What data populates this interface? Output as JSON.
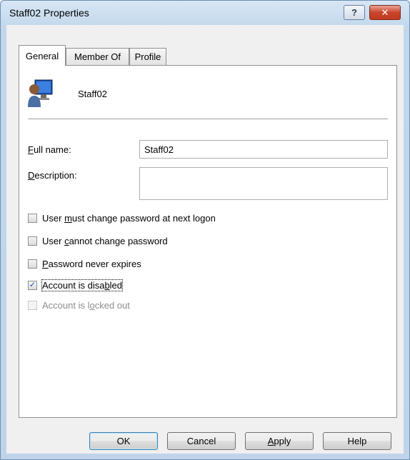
{
  "window": {
    "title": "Staff02 Properties",
    "help_label": "?",
    "close_label": "✕"
  },
  "tabs": [
    {
      "label": "General",
      "active": true
    },
    {
      "label": "Member Of",
      "active": false
    },
    {
      "label": "Profile",
      "active": false
    }
  ],
  "general": {
    "user_display_name": "Staff02",
    "user_icon": "user-computer-icon",
    "full_name": {
      "label_prefix": "",
      "label_accel": "F",
      "label_rest": "ull name:",
      "value": "Staff02"
    },
    "description": {
      "label_prefix": "",
      "label_accel": "D",
      "label_rest": "escription:",
      "value": ""
    },
    "checkboxes": [
      {
        "prefix": "User ",
        "accel": "m",
        "rest": "ust change password at next logon",
        "checked": false,
        "enabled": true
      },
      {
        "prefix": "User ",
        "accel": "c",
        "rest": "annot change password",
        "checked": false,
        "enabled": true
      },
      {
        "prefix": "",
        "accel": "P",
        "rest": "assword never expires",
        "checked": false,
        "enabled": true
      },
      {
        "prefix": "Account is disa",
        "accel": "b",
        "rest": "led",
        "checked": true,
        "enabled": true
      },
      {
        "prefix": "Account is l",
        "accel": "o",
        "rest": "cked out",
        "checked": false,
        "enabled": false
      }
    ]
  },
  "buttons": {
    "ok": "OK",
    "cancel": "Cancel",
    "apply_accel": "A",
    "apply_rest": "pply",
    "help": "Help"
  },
  "colors": {
    "title_gradient_top": "#d6e6f5",
    "close_red": "#c8452c",
    "panel_bg": "#f0f0f0",
    "check_mark": "#2b4ea0"
  }
}
